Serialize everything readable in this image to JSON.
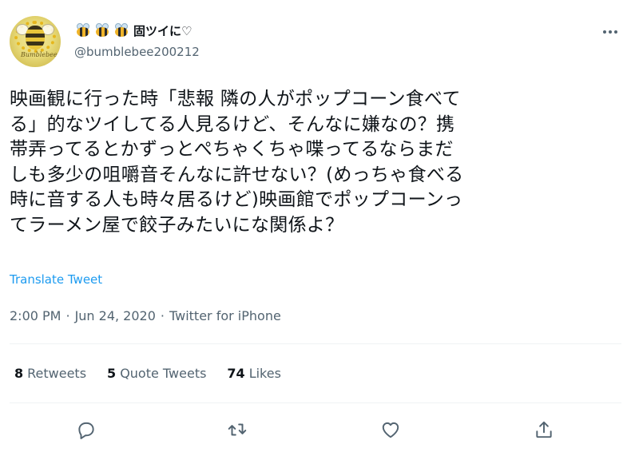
{
  "user": {
    "display_name": "固ツイに♡",
    "display_emoji_icon": "honeybee-icon",
    "handle": "@bumblebee200212",
    "avatar_signature": "Bumblebee"
  },
  "tweet": {
    "text": "映画観に行った時「悲報 隣の人がポップコーン食べて\nる」的なツイしてる人見るけど、そんなに嫌なの？携\n帯弄ってるとかずっとぺちゃくちゃ喋ってるならまだ\nしも多少の咀嚼音そんなに許せない？(めっちゃ食べる\n時に音する人も時々居るけど)映画館でポップコーンっ\nてラーメン屋で餃子みたいにな関係よ？",
    "translate_label": "Translate Tweet",
    "time": "2:00 PM",
    "dot1": "·",
    "date": "Jun 24, 2020",
    "dot2": "·",
    "source": "Twitter for iPhone"
  },
  "stats": [
    {
      "num": "8",
      "label": "Retweets"
    },
    {
      "num": "5",
      "label": "Quote Tweets"
    },
    {
      "num": "74",
      "label": "Likes"
    }
  ],
  "actions": {
    "reply_icon": "reply-icon",
    "retweet_icon": "retweet-icon",
    "like_icon": "heart-icon",
    "share_icon": "share-icon"
  },
  "colors": {
    "text": "#0f1419",
    "secondary": "#536471",
    "link": "#1d9bf0",
    "divider": "#eff3f4"
  }
}
